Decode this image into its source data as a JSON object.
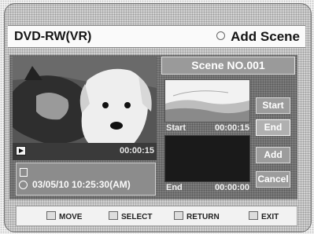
{
  "header": {
    "mode_label": "DVD-RW(VR)",
    "title": "Add Scene",
    "title_icon": "circle-icon"
  },
  "preview": {
    "play_icon": "play-icon",
    "elapsed": "00:00:15",
    "info_icons": [
      "disc-icon",
      "clock-icon"
    ],
    "recorded_datetime": "03/05/10 10:25:30(AM)"
  },
  "scene": {
    "title": "Scene NO.001",
    "start_label": "Start",
    "start_time": "00:00:15",
    "end_label": "End",
    "end_time": "00:00:00"
  },
  "buttons": {
    "start": "Start",
    "end": "End",
    "add": "Add",
    "cancel": "Cancel"
  },
  "footer": {
    "move": "MOVE",
    "select": "SELECT",
    "return": "RETURN",
    "exit": "EXIT"
  }
}
